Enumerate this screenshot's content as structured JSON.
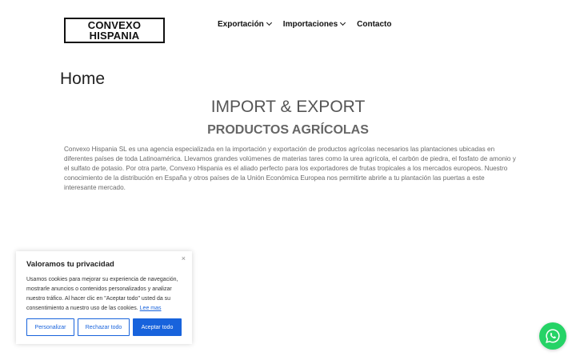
{
  "header": {
    "logo_line1": "CONVEXO",
    "logo_line2": "HISPANIA",
    "nav": [
      {
        "label": "Exportación",
        "has_dropdown": true
      },
      {
        "label": "Importaciones",
        "has_dropdown": true
      },
      {
        "label": "Contacto",
        "has_dropdown": false
      }
    ]
  },
  "main": {
    "page_title": "Home",
    "heading": "IMPORT & EXPORT",
    "subheading": "PRODUCTOS AGRÍCOLAS",
    "body": "Convexo Hispania SL es una agencia especializada en la importación y exportación de productos agrícolas necesarios las plantaciones ubicadas en diferentes países de toda Latinoamérica. Llevamos grandes volúmenes de materias tares como la urea agrícola, el carbón de piedra, el fosfato de amonio y el sulfato de potasio. Por otra parte, Convexo Hispania es el aliado perfecto para los exportadores de frutas tropicales a los mercados europeos. Nuestro conocimiento de la distribución en España y otros países de la Unión Económica Europea nos permitirte abrirle a tu plantación  las puertas a este interesante mercado."
  },
  "cookie_banner": {
    "title": "Valoramos tu privacidad",
    "text": "Usamos cookies para mejorar su experiencia de navegación, mostrarle anuncios o contenidos personalizados y analizar nuestro tráfico. Al hacer clic en \"Aceptar todo\" usted da su consentimiento a nuestro uso de las cookies.",
    "link": "Lee mas",
    "close": "×",
    "buttons": {
      "customize": "Personalizar",
      "reject": "Rechazar todo",
      "accept": "Aceptar todo"
    }
  },
  "colors": {
    "accent": "#1863dc",
    "whatsapp": "#25d366"
  },
  "icons": {
    "dropdown": "chevron-down-icon",
    "chat": "whatsapp-icon",
    "close": "close-icon"
  }
}
